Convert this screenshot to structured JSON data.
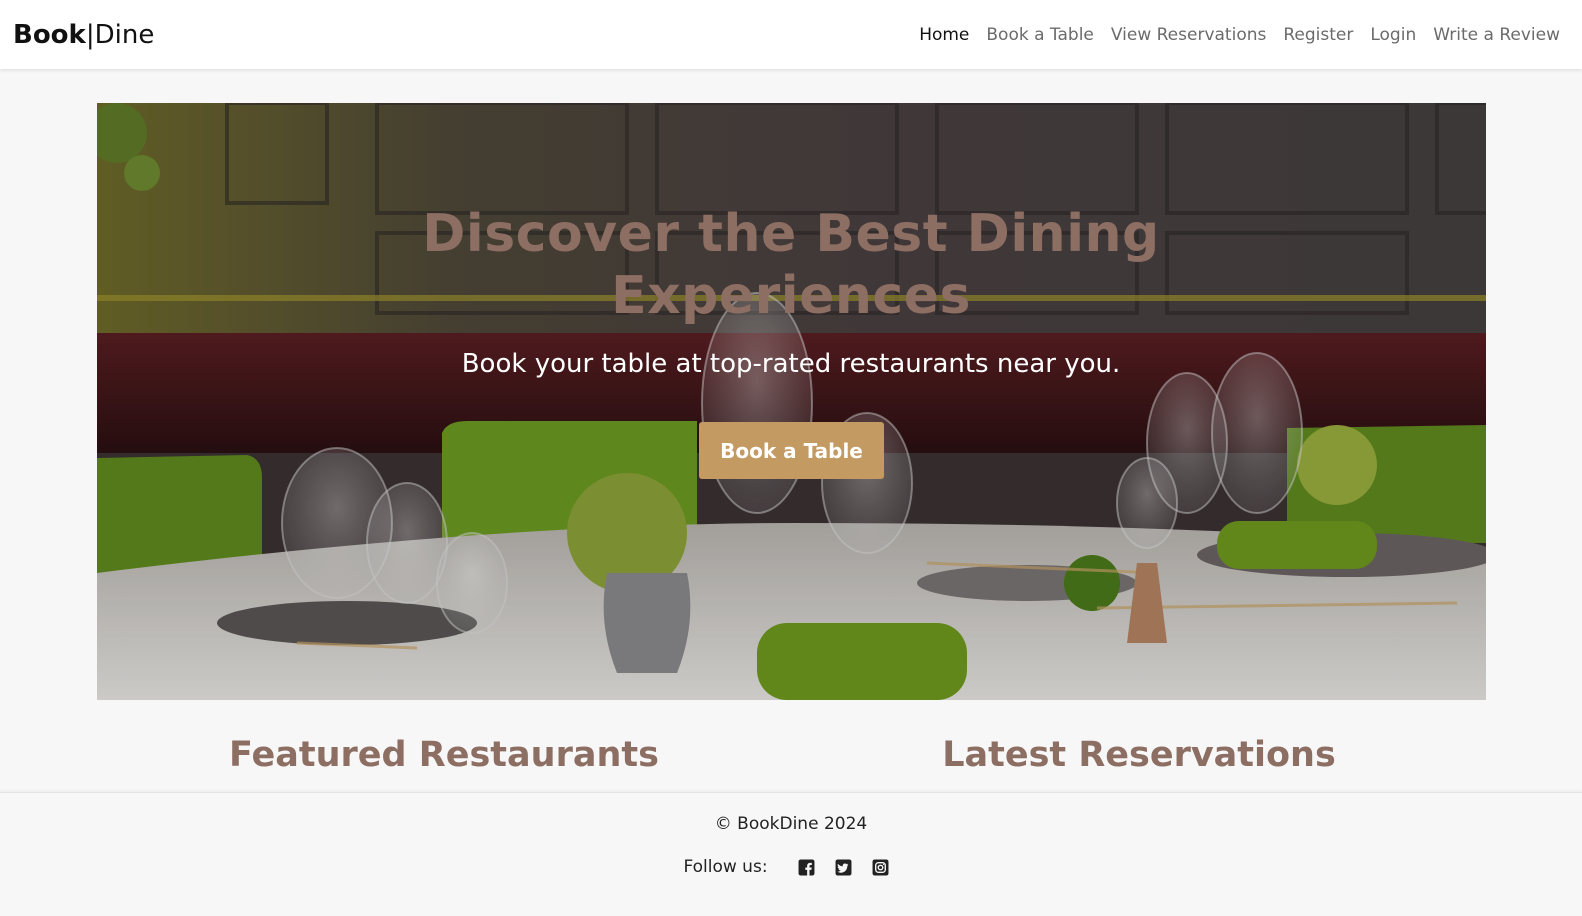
{
  "header": {
    "brand_bold": "Book",
    "brand_sep": "|",
    "brand_light": "Dine",
    "nav": [
      {
        "label": "Home"
      },
      {
        "label": "Book a Table"
      },
      {
        "label": "View Reservations"
      },
      {
        "label": "Register"
      },
      {
        "label": "Login"
      },
      {
        "label": "Write a Review"
      }
    ]
  },
  "hero": {
    "title": "Discover the Best Dining Experiences",
    "subtitle": "Book your table at top-rated restaurants near you.",
    "cta_label": "Book a Table"
  },
  "sections": {
    "featured_title": "Featured Restaurants",
    "latest_title": "Latest Reservations"
  },
  "footer": {
    "copyright": "© BookDine 2024",
    "follow_label": "Follow us:",
    "social_icons": [
      "facebook-icon",
      "twitter-icon",
      "instagram-icon"
    ]
  },
  "colors": {
    "accent": "#8d6e63",
    "button": "#c49a63",
    "nav_active": "#111111",
    "nav_inactive": "#6b6b6b"
  }
}
